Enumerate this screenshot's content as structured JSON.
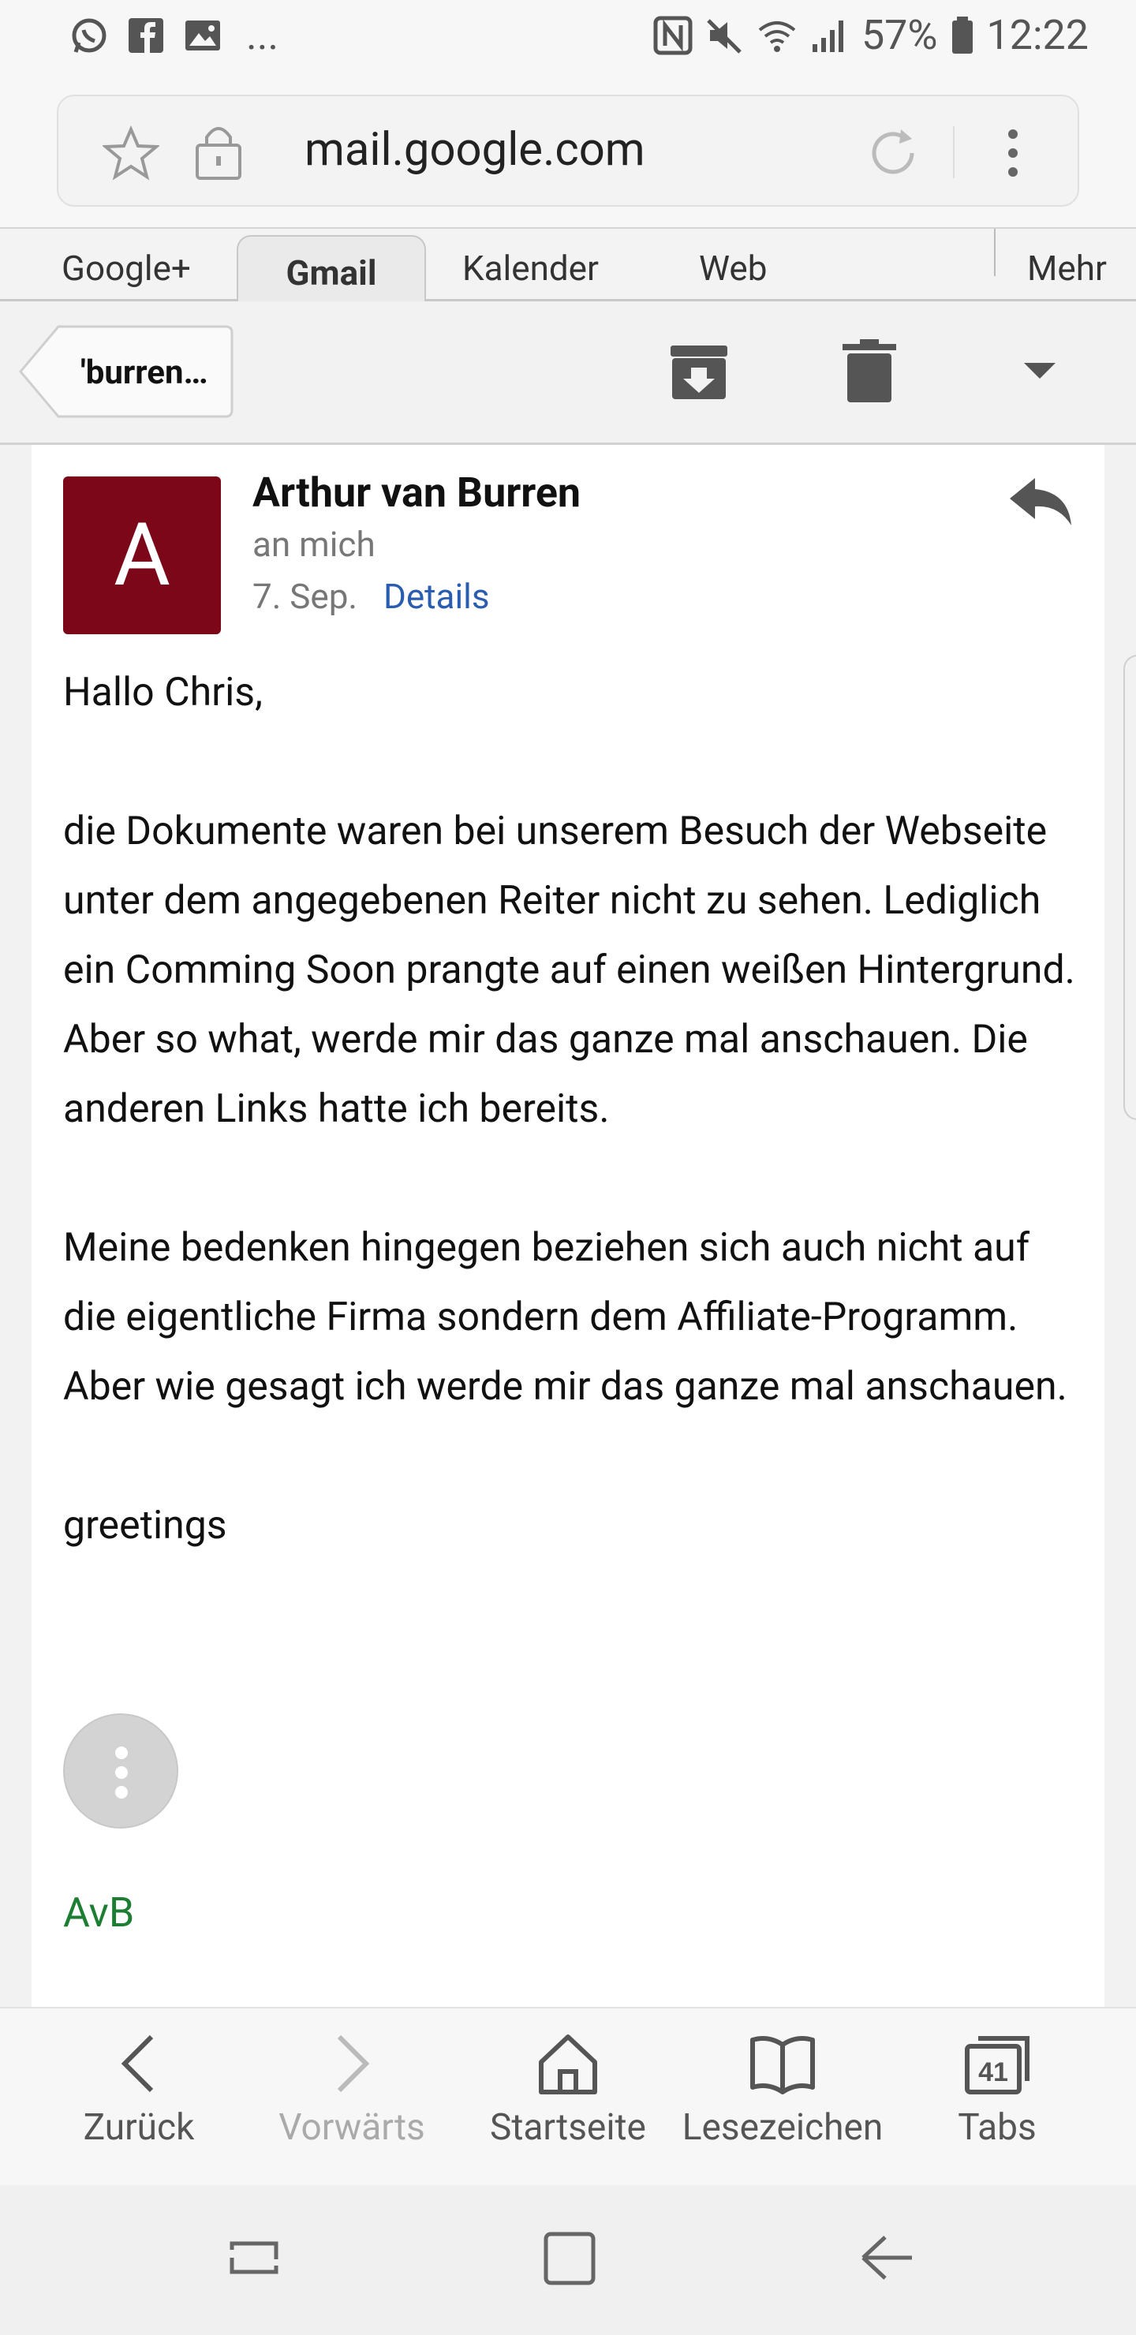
{
  "status_bar": {
    "overflow": "...",
    "battery": "57%",
    "time": "12:22",
    "icons": [
      "whatsapp-icon",
      "facebook-icon",
      "image-icon",
      "nfc-icon",
      "mute-icon",
      "wifi-icon",
      "signal-icon",
      "battery-icon"
    ]
  },
  "browser": {
    "url": "mail.google.com"
  },
  "google_tabs": [
    {
      "label": "Google+"
    },
    {
      "label": "Gmail"
    },
    {
      "label": "Kalender"
    },
    {
      "label": "Web"
    },
    {
      "label": "Mehr"
    }
  ],
  "action_bar": {
    "back_label": "'burren…"
  },
  "email": {
    "avatar_letter": "A",
    "avatar_color": "#7b0718",
    "sender": "Arthur van Burren",
    "to": "an mich",
    "date": "7. Sep.",
    "details_link": "Details",
    "greeting": "Hallo Chris,",
    "paragraph1": "die Dokumente waren bei unserem Besuch der Webseite unter dem angegebenen Reiter nicht zu sehen. Lediglich ein Comming Soon prangte auf einen weißen Hintergrund. Aber so what, werde mir das ganze mal anschauen. Die anderen Links hatte ich bereits.",
    "paragraph2": "Meine bedenken hingegen beziehen sich auch nicht auf die eigentliche Firma sondern dem Affiliate-Programm. Aber wie gesagt ich werde mir das ganze mal anschauen.",
    "closing": "greetings",
    "signature": "AvB",
    "signature_color": "#1d7e33"
  },
  "browser_toolbar": {
    "back": "Zurück",
    "forward": "Vorwärts",
    "home": "Startseite",
    "bookmarks": "Lesezeichen",
    "tabs": "Tabs",
    "tab_count": "41"
  }
}
